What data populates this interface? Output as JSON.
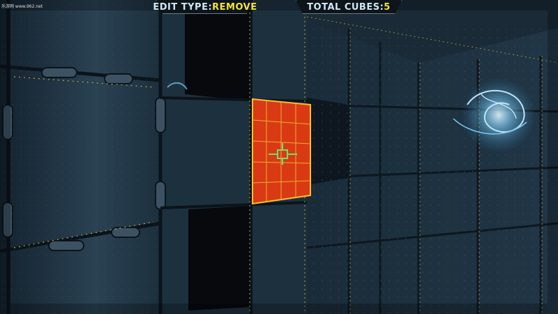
{
  "hud": {
    "edit_type_label": "EDIT TYPE:",
    "edit_type_value": "REMOVE",
    "total_cubes_label": "TOTAL CUBES:",
    "total_cubes_value": "5"
  },
  "watermark": "乐游网 www.962.net",
  "colors": {
    "hud_value": "#f3e33a",
    "hud_text": "#cfe8f0",
    "selected_face": "#d93a14",
    "selected_grid": "#f1c232",
    "crosshair": "#6ee06a",
    "panel_trim": "#b8a24a",
    "energy": "#7fd4ff"
  },
  "icons": [
    "crosshair-icon"
  ]
}
